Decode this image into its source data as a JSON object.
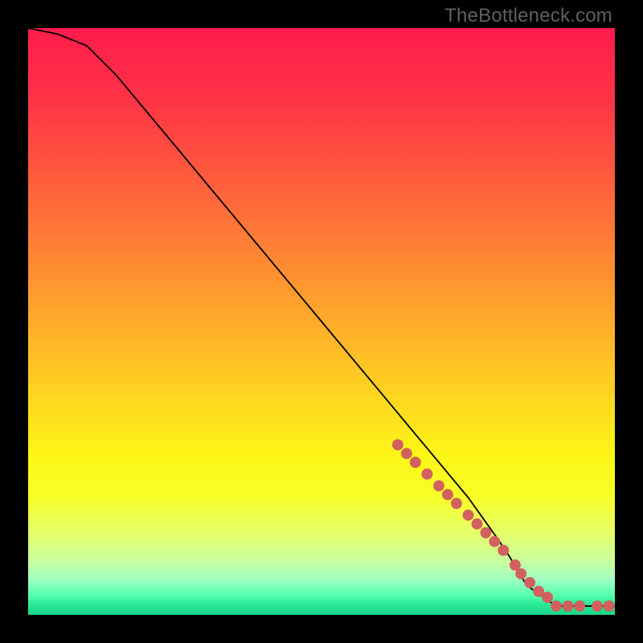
{
  "watermark": "TheBottleneck.com",
  "chart_data": {
    "type": "line",
    "title": "",
    "xlabel": "",
    "ylabel": "",
    "xlim": [
      0,
      100
    ],
    "ylim": [
      0,
      100
    ],
    "grid": false,
    "legend": false,
    "background": "rainbow-gradient",
    "series": [
      {
        "name": "curve",
        "stroke": "#000000",
        "x": [
          0,
          5,
          10,
          15,
          20,
          25,
          30,
          35,
          40,
          45,
          50,
          55,
          60,
          65,
          70,
          75,
          80,
          82,
          85,
          90,
          95,
          100
        ],
        "values": [
          100,
          99,
          97,
          92,
          86,
          80,
          74,
          68,
          62,
          56,
          50,
          44,
          38,
          32,
          26,
          20,
          13,
          10,
          5,
          1.5,
          1.5,
          1.5
        ]
      },
      {
        "name": "markers",
        "marker_color": "#d1605e",
        "x": [
          63,
          64.5,
          66,
          68,
          70,
          71.5,
          73,
          75,
          76.5,
          78,
          79.5,
          81,
          83,
          84,
          85.5,
          87,
          88.5,
          90,
          92,
          94,
          97,
          99
        ],
        "values": [
          29,
          27.5,
          26,
          24,
          22,
          20.5,
          19,
          17,
          15.5,
          14,
          12.5,
          11,
          8.5,
          7,
          5.5,
          4,
          3,
          1.5,
          1.5,
          1.5,
          1.5,
          1.5
        ]
      }
    ]
  },
  "gradient_stops": [
    {
      "offset": 0,
      "color": "#fe1c4c"
    },
    {
      "offset": 12,
      "color": "#ff3346"
    },
    {
      "offset": 25,
      "color": "#ff5a3e"
    },
    {
      "offset": 38,
      "color": "#ff8334"
    },
    {
      "offset": 50,
      "color": "#ffab2a"
    },
    {
      "offset": 62,
      "color": "#ffd321"
    },
    {
      "offset": 73,
      "color": "#fdf617"
    },
    {
      "offset": 80,
      "color": "#f7ff28"
    },
    {
      "offset": 86,
      "color": "#e6ff6a"
    },
    {
      "offset": 91,
      "color": "#c8ffa0"
    },
    {
      "offset": 94,
      "color": "#9effc2"
    },
    {
      "offset": 96.5,
      "color": "#5affb0"
    },
    {
      "offset": 98,
      "color": "#2eec99"
    },
    {
      "offset": 100,
      "color": "#18d688"
    }
  ]
}
